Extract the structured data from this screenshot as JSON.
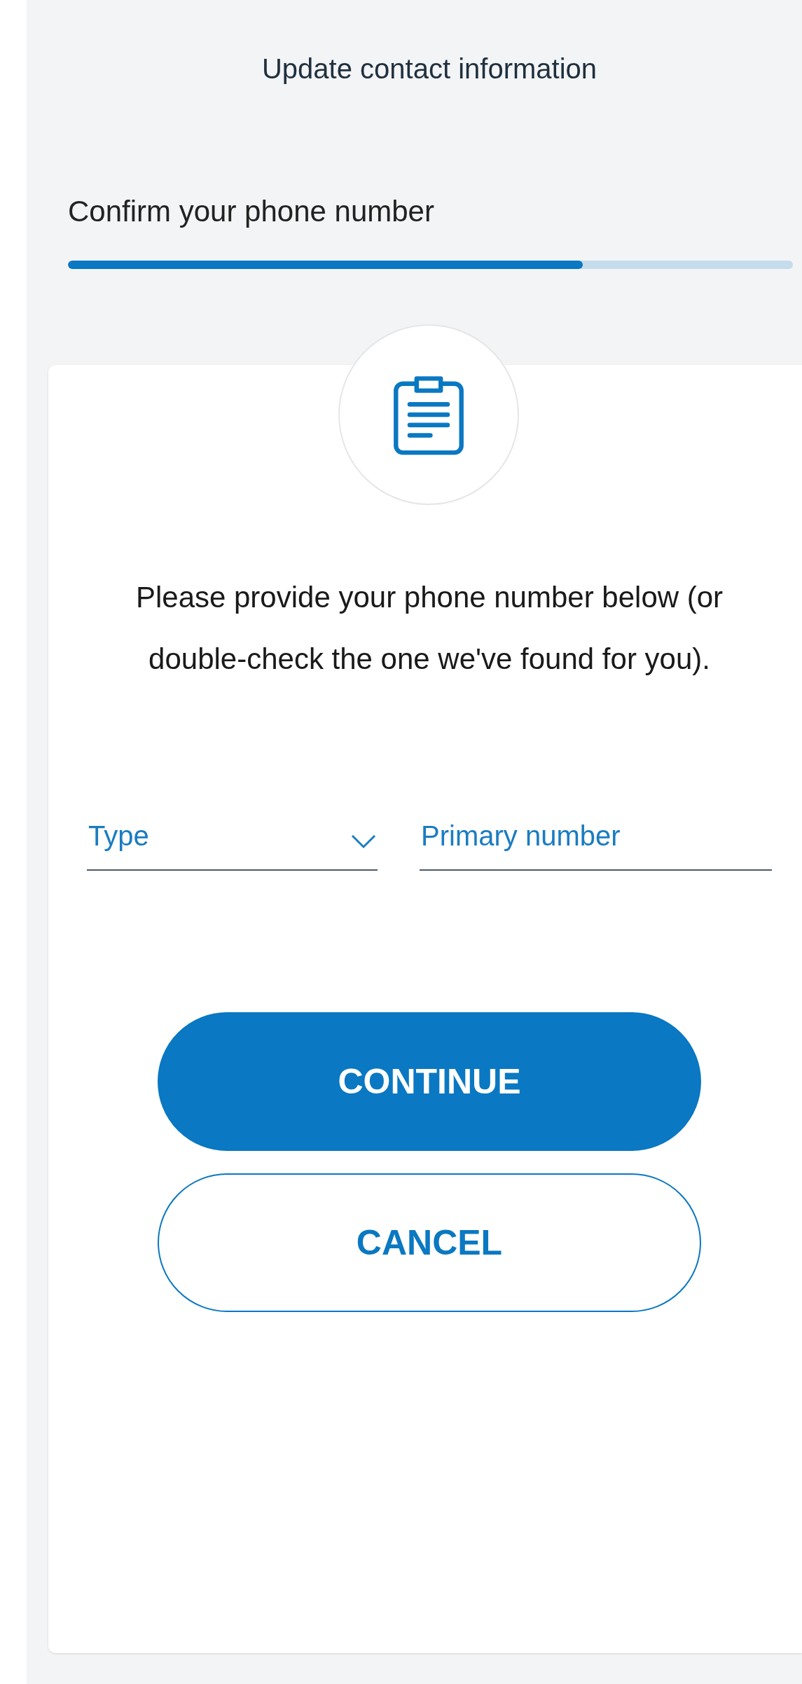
{
  "header": {
    "title": "Update contact information"
  },
  "step": {
    "title": "Confirm your phone number",
    "progress": {
      "level": 0.71
    }
  },
  "card": {
    "message": "Please provide your phone number below (or double-check the one we've found for you).",
    "fields": [
      {
        "kind": "select",
        "placeholder": "Type"
      },
      {
        "kind": "text",
        "placeholder": "Primary number"
      }
    ],
    "buttons": [
      {
        "kind": "primary",
        "label": "CONTINUE"
      },
      {
        "kind": "secondary",
        "label": "CANCEL"
      }
    ]
  }
}
